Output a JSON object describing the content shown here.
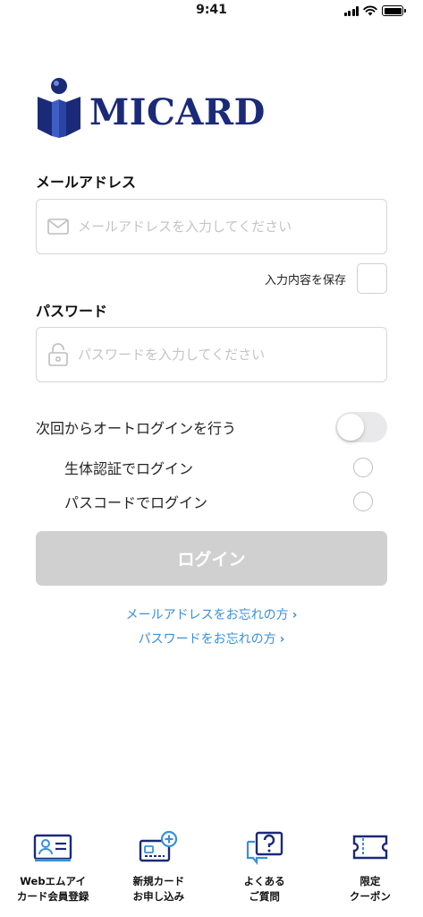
{
  "status_bar": {
    "time": "9:41"
  },
  "logo": {
    "text": "MICARD"
  },
  "email": {
    "label": "メールアドレス",
    "placeholder": "メールアドレスを入力してください",
    "value": ""
  },
  "save": {
    "label": "入力内容を保存",
    "checked": false
  },
  "password": {
    "label": "パスワード",
    "placeholder": "パスワードを入力してください",
    "value": ""
  },
  "auto_login": {
    "label": "次回からオートログインを行う",
    "enabled": false,
    "options": [
      {
        "label": "生体認証でログイン",
        "selected": false
      },
      {
        "label": "パスコードでログイン",
        "selected": false
      }
    ]
  },
  "login_button": {
    "label": "ログイン",
    "state": "disabled"
  },
  "links": {
    "forgot_email": "メールアドレスをお忘れの方",
    "forgot_password": "パスワードをお忘れの方",
    "chevron": "›"
  },
  "bottom_nav": [
    {
      "line1": "Webエムアイ",
      "line2": "カード会員登録",
      "icon": "member-card-icon"
    },
    {
      "line1": "新規カード",
      "line2": "お申し込み",
      "icon": "new-card-icon"
    },
    {
      "line1": "よくある",
      "line2": "ご質問",
      "icon": "faq-icon"
    },
    {
      "line1": "限定",
      "line2": "クーポン",
      "icon": "coupon-icon"
    }
  ],
  "colors": {
    "brand": "#1b2a78",
    "link": "#3a8fd9",
    "button_disabled": "#d0d0d0"
  }
}
